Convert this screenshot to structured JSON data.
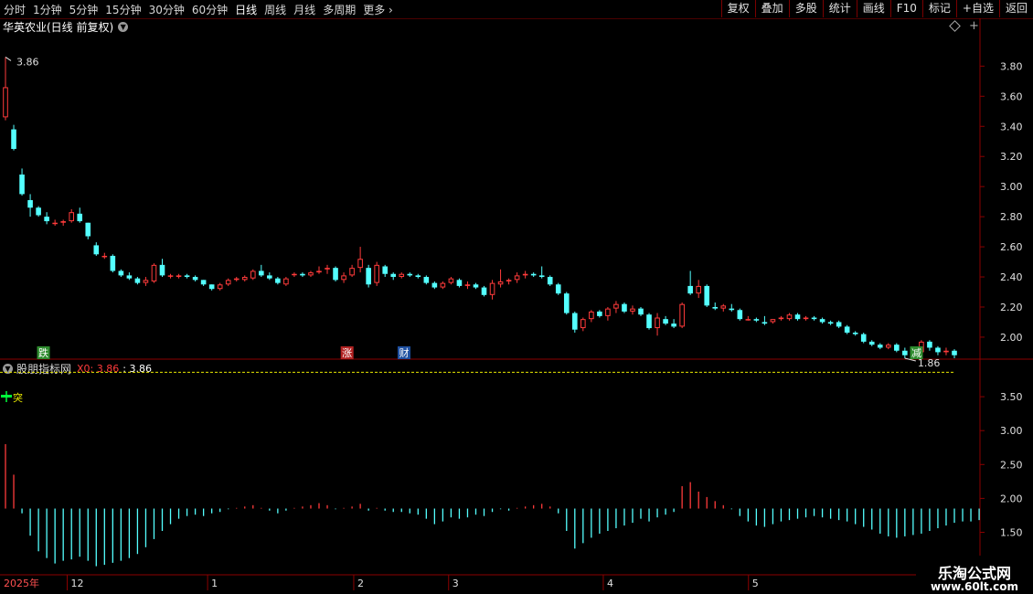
{
  "toolbar": {
    "periods": [
      "分时",
      "1分钟",
      "5分钟",
      "15分钟",
      "30分钟",
      "60分钟",
      "日线",
      "周线",
      "月线",
      "多周期",
      "更多"
    ],
    "active": "日线",
    "right_buttons": [
      "复权",
      "叠加",
      "多股",
      "统计",
      "画线",
      "F10",
      "标记",
      "+自选",
      "返回"
    ]
  },
  "main": {
    "stock_name": "华英农业(日线 前复权)",
    "high_label": "3.86",
    "low_label": "1.86",
    "y_ticks": [
      "3.80",
      "3.60",
      "3.40",
      "3.20",
      "3.00",
      "2.80",
      "2.60",
      "2.40",
      "2.20",
      "2.00"
    ],
    "events": [
      {
        "label": "跌",
        "color": "#2e8b2e",
        "x": 0.04
      },
      {
        "label": "涨",
        "color": "#b22222",
        "x": 0.36
      },
      {
        "label": "财",
        "color": "#1e4fa0",
        "x": 0.42
      },
      {
        "label": "减",
        "color": "#2e8b2e",
        "x": 0.96
      }
    ]
  },
  "indicator": {
    "name": "股朋指标网",
    "x0_label": "X0: 3.86",
    "x0_value": ": 3.86",
    "signal_label": "突",
    "y_ticks": [
      "3.50",
      "3.00",
      "2.50",
      "2.00",
      "1.50"
    ]
  },
  "xaxis": {
    "year_label": "2025年",
    "month_labels": [
      {
        "label": "12",
        "pos": 0.013
      },
      {
        "label": "1",
        "pos": 0.213
      },
      {
        "label": "2",
        "pos": 0.367
      },
      {
        "label": "3",
        "pos": 0.467
      },
      {
        "label": "4",
        "pos": 0.63
      },
      {
        "label": "5",
        "pos": 0.783
      }
    ]
  },
  "watermark": {
    "line1": "乐淘公式网",
    "line2": "www.60lt.com"
  },
  "colors": {
    "up": "#ff3b3b",
    "down": "#54ffff",
    "axis": "#8b0000",
    "grid": "#330000"
  },
  "chart_data": {
    "type": "candlestick",
    "series": [
      {
        "name": "price",
        "values": [
          [
            3.46,
            3.86,
            3.44,
            3.66
          ],
          [
            3.38,
            3.41,
            3.24,
            3.25
          ],
          [
            3.08,
            3.12,
            2.94,
            2.95
          ],
          [
            2.91,
            2.95,
            2.8,
            2.86
          ],
          [
            2.86,
            2.87,
            2.8,
            2.81
          ],
          [
            2.8,
            2.83,
            2.75,
            2.77
          ],
          [
            2.76,
            2.78,
            2.74,
            2.76
          ],
          [
            2.76,
            2.78,
            2.74,
            2.77
          ],
          [
            2.77,
            2.85,
            2.76,
            2.83
          ],
          [
            2.82,
            2.86,
            2.76,
            2.77
          ],
          [
            2.76,
            2.76,
            2.65,
            2.67
          ],
          [
            2.61,
            2.63,
            2.54,
            2.55
          ],
          [
            2.54,
            2.56,
            2.52,
            2.54
          ],
          [
            2.54,
            2.55,
            2.43,
            2.44
          ],
          [
            2.44,
            2.45,
            2.4,
            2.41
          ],
          [
            2.41,
            2.43,
            2.38,
            2.39
          ],
          [
            2.39,
            2.4,
            2.35,
            2.36
          ],
          [
            2.36,
            2.4,
            2.34,
            2.38
          ],
          [
            2.37,
            2.49,
            2.36,
            2.48
          ],
          [
            2.48,
            2.52,
            2.4,
            2.41
          ],
          [
            2.41,
            2.42,
            2.39,
            2.41
          ],
          [
            2.4,
            2.42,
            2.39,
            2.41
          ],
          [
            2.41,
            2.42,
            2.39,
            2.4
          ],
          [
            2.4,
            2.41,
            2.37,
            2.38
          ],
          [
            2.38,
            2.38,
            2.34,
            2.35
          ],
          [
            2.35,
            2.35,
            2.31,
            2.32
          ],
          [
            2.32,
            2.36,
            2.31,
            2.35
          ],
          [
            2.35,
            2.39,
            2.34,
            2.38
          ],
          [
            2.38,
            2.4,
            2.37,
            2.39
          ],
          [
            2.38,
            2.41,
            2.37,
            2.4
          ],
          [
            2.39,
            2.45,
            2.38,
            2.44
          ],
          [
            2.44,
            2.48,
            2.4,
            2.41
          ],
          [
            2.41,
            2.43,
            2.38,
            2.39
          ],
          [
            2.39,
            2.4,
            2.35,
            2.36
          ],
          [
            2.35,
            2.4,
            2.34,
            2.39
          ],
          [
            2.42,
            2.43,
            2.4,
            2.42
          ],
          [
            2.42,
            2.43,
            2.4,
            2.41
          ],
          [
            2.41,
            2.44,
            2.4,
            2.43
          ],
          [
            2.43,
            2.47,
            2.42,
            2.44
          ],
          [
            2.45,
            2.48,
            2.42,
            2.46
          ],
          [
            2.46,
            2.47,
            2.37,
            2.38
          ],
          [
            2.38,
            2.43,
            2.36,
            2.41
          ],
          [
            2.41,
            2.48,
            2.4,
            2.46
          ],
          [
            2.46,
            2.6,
            2.43,
            2.52
          ],
          [
            2.46,
            2.48,
            2.33,
            2.35
          ],
          [
            2.36,
            2.5,
            2.34,
            2.48
          ],
          [
            2.47,
            2.48,
            2.4,
            2.42
          ],
          [
            2.42,
            2.43,
            2.38,
            2.4
          ],
          [
            2.4,
            2.43,
            2.39,
            2.42
          ],
          [
            2.42,
            2.43,
            2.4,
            2.41
          ],
          [
            2.41,
            2.42,
            2.39,
            2.4
          ],
          [
            2.4,
            2.41,
            2.35,
            2.36
          ],
          [
            2.36,
            2.37,
            2.32,
            2.33
          ],
          [
            2.33,
            2.37,
            2.32,
            2.36
          ],
          [
            2.36,
            2.4,
            2.35,
            2.39
          ],
          [
            2.38,
            2.39,
            2.33,
            2.34
          ],
          [
            2.34,
            2.37,
            2.32,
            2.35
          ],
          [
            2.35,
            2.36,
            2.32,
            2.33
          ],
          [
            2.33,
            2.34,
            2.27,
            2.28
          ],
          [
            2.28,
            2.38,
            2.25,
            2.36
          ],
          [
            2.35,
            2.45,
            2.33,
            2.37
          ],
          [
            2.37,
            2.39,
            2.35,
            2.38
          ],
          [
            2.38,
            2.43,
            2.36,
            2.41
          ],
          [
            2.41,
            2.44,
            2.39,
            2.42
          ],
          [
            2.42,
            2.43,
            2.4,
            2.41
          ],
          [
            2.41,
            2.47,
            2.39,
            2.4
          ],
          [
            2.4,
            2.41,
            2.34,
            2.35
          ],
          [
            2.35,
            2.36,
            2.28,
            2.29
          ],
          [
            2.29,
            2.3,
            2.15,
            2.16
          ],
          [
            2.16,
            2.17,
            2.03,
            2.05
          ],
          [
            2.06,
            2.13,
            2.04,
            2.12
          ],
          [
            2.12,
            2.18,
            2.1,
            2.17
          ],
          [
            2.17,
            2.18,
            2.13,
            2.14
          ],
          [
            2.14,
            2.2,
            2.11,
            2.19
          ],
          [
            2.19,
            2.24,
            2.16,
            2.22
          ],
          [
            2.22,
            2.23,
            2.16,
            2.17
          ],
          [
            2.17,
            2.21,
            2.15,
            2.19
          ],
          [
            2.19,
            2.2,
            2.14,
            2.15
          ],
          [
            2.15,
            2.16,
            2.05,
            2.06
          ],
          [
            2.06,
            2.16,
            2.01,
            2.13
          ],
          [
            2.12,
            2.14,
            2.08,
            2.09
          ],
          [
            2.09,
            2.12,
            2.06,
            2.07
          ],
          [
            2.07,
            2.23,
            2.06,
            2.22
          ],
          [
            2.34,
            2.44,
            2.28,
            2.29
          ],
          [
            2.29,
            2.38,
            2.26,
            2.34
          ],
          [
            2.34,
            2.35,
            2.2,
            2.21
          ],
          [
            2.2,
            2.23,
            2.18,
            2.19
          ],
          [
            2.19,
            2.22,
            2.17,
            2.21
          ],
          [
            2.19,
            2.22,
            2.17,
            2.18
          ],
          [
            2.18,
            2.19,
            2.11,
            2.12
          ],
          [
            2.12,
            2.14,
            2.11,
            2.12
          ],
          [
            2.12,
            2.13,
            2.1,
            2.11
          ],
          [
            2.1,
            2.14,
            2.08,
            2.09
          ],
          [
            2.1,
            2.12,
            2.09,
            2.12
          ],
          [
            2.12,
            2.14,
            2.11,
            2.13
          ],
          [
            2.12,
            2.16,
            2.11,
            2.15
          ],
          [
            2.15,
            2.16,
            2.11,
            2.12
          ],
          [
            2.12,
            2.14,
            2.11,
            2.13
          ],
          [
            2.13,
            2.14,
            2.11,
            2.12
          ],
          [
            2.12,
            2.13,
            2.09,
            2.1
          ],
          [
            2.1,
            2.11,
            2.08,
            2.09
          ],
          [
            2.1,
            2.11,
            2.06,
            2.07
          ],
          [
            2.07,
            2.08,
            2.02,
            2.03
          ],
          [
            2.03,
            2.04,
            2.01,
            2.02
          ],
          [
            2.02,
            2.03,
            1.96,
            1.97
          ],
          [
            1.97,
            1.98,
            1.94,
            1.95
          ],
          [
            1.95,
            1.96,
            1.92,
            1.93
          ],
          [
            1.93,
            1.96,
            1.92,
            1.95
          ],
          [
            1.95,
            1.96,
            1.9,
            1.91
          ],
          [
            1.91,
            1.93,
            1.86,
            1.88
          ],
          [
            1.88,
            1.91,
            1.87,
            1.9
          ],
          [
            1.9,
            1.98,
            1.88,
            1.97
          ],
          [
            1.97,
            1.98,
            1.91,
            1.93
          ],
          [
            1.93,
            1.94,
            1.88,
            1.9
          ],
          [
            1.9,
            1.93,
            1.88,
            1.91
          ],
          [
            1.91,
            1.92,
            1.86,
            1.88
          ]
        ]
      }
    ],
    "ylim": [
      1.86,
      3.96
    ],
    "indicator_bars": [
      2.8,
      2.35,
      1.78,
      1.45,
      1.22,
      1.12,
      1.04,
      1.08,
      1.1,
      1.14,
      1.08,
      1.0,
      1.02,
      1.05,
      1.08,
      1.12,
      1.18,
      1.28,
      1.4,
      1.52,
      1.62,
      1.7,
      1.74,
      1.76,
      1.74,
      1.78,
      1.8,
      1.84,
      1.86,
      1.88,
      1.9,
      1.86,
      1.82,
      1.78,
      1.82,
      1.86,
      1.88,
      1.9,
      1.93,
      1.9,
      1.84,
      1.86,
      1.88,
      1.92,
      1.82,
      1.86,
      1.82,
      1.8,
      1.8,
      1.78,
      1.76,
      1.7,
      1.62,
      1.66,
      1.72,
      1.7,
      1.72,
      1.76,
      1.74,
      1.8,
      1.84,
      1.82,
      1.86,
      1.88,
      1.9,
      1.92,
      1.88,
      1.78,
      1.52,
      1.26,
      1.34,
      1.42,
      1.48,
      1.52,
      1.56,
      1.6,
      1.64,
      1.7,
      1.66,
      1.72,
      1.76,
      1.8,
      2.18,
      2.24,
      2.1,
      2.02,
      1.96,
      1.9,
      1.84,
      1.74,
      1.66,
      1.6,
      1.58,
      1.62,
      1.66,
      1.68,
      1.7,
      1.72,
      1.74,
      1.72,
      1.7,
      1.68,
      1.66,
      1.62,
      1.58,
      1.54,
      1.48,
      1.44,
      1.42,
      1.44,
      1.46,
      1.48,
      1.52,
      1.56,
      1.6,
      1.64,
      1.66,
      1.66,
      1.68
    ],
    "indicator_ylim": [
      0.9,
      4.0
    ],
    "x0_line": 3.86
  }
}
